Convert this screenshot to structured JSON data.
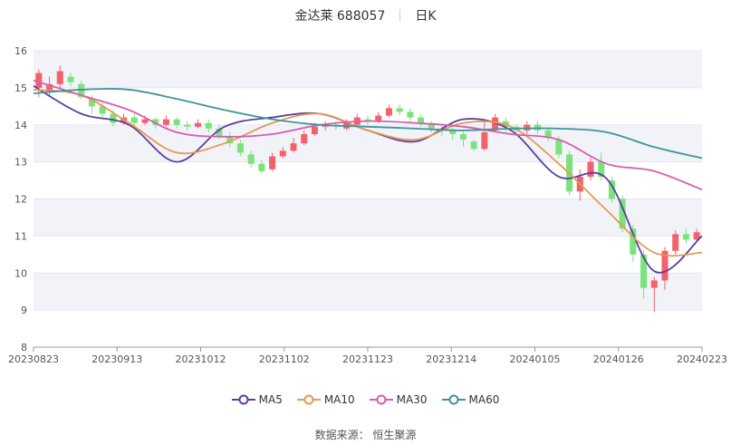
{
  "header": {
    "stock": "金达莱 688057",
    "period": "日K"
  },
  "source": "数据来源：  恒生聚源",
  "colors": {
    "up": "#f4606c",
    "down": "#7be37b",
    "band": "#f2f3f9",
    "MA5": "#5c3ea3",
    "MA10": "#e39b4f",
    "MA30": "#d65cb2",
    "MA60": "#3e9499"
  },
  "chart_data": {
    "type": "line",
    "title": "金达莱 688057 日K",
    "ylim": [
      8,
      16
    ],
    "yticks": [
      8,
      9,
      10,
      11,
      12,
      13,
      14,
      15,
      16
    ],
    "xticks": [
      "20230823",
      "20230913",
      "20231012",
      "20231102",
      "20231123",
      "20231214",
      "20240105",
      "20240126",
      "20240223"
    ],
    "dates": [
      "20230823",
      "20230913",
      "20231012",
      "20231102",
      "20231123",
      "20231214",
      "20240105",
      "20240126",
      "20240223"
    ],
    "series": [
      {
        "name": "MA5",
        "color": "#5c3ea3",
        "values": [
          15.05,
          14.3,
          14.0,
          13.0,
          13.95,
          14.2,
          14.3,
          13.85,
          13.55,
          14.15,
          13.85,
          12.6,
          12.55,
          10.05,
          11.0
        ]
      },
      {
        "name": "MA10",
        "color": "#e39b4f",
        "values": [
          14.95,
          14.8,
          14.05,
          13.25,
          13.5,
          14.05,
          14.3,
          13.85,
          13.6,
          14.05,
          13.95,
          12.95,
          11.7,
          10.55,
          10.55
        ]
      },
      {
        "name": "MA30",
        "color": "#d65cb2",
        "values": [
          15.2,
          14.8,
          14.4,
          13.8,
          13.68,
          13.75,
          14.0,
          14.1,
          14.05,
          13.95,
          13.75,
          13.6,
          12.95,
          12.75,
          12.25
        ]
      },
      {
        "name": "MA60",
        "color": "#3e9499",
        "values": [
          14.85,
          14.95,
          14.95,
          14.7,
          14.4,
          14.15,
          14.0,
          13.95,
          13.9,
          13.85,
          13.9,
          13.9,
          13.8,
          13.4,
          13.1
        ]
      }
    ],
    "candles": [
      [
        15.0,
        15.4,
        14.75,
        15.5
      ],
      [
        14.9,
        15.1,
        14.8,
        15.3
      ],
      [
        15.1,
        15.45,
        15.0,
        15.6
      ],
      [
        15.3,
        15.15,
        15.05,
        15.4
      ],
      [
        15.1,
        14.75,
        14.7,
        15.2
      ],
      [
        14.7,
        14.5,
        14.3,
        14.8
      ],
      [
        14.5,
        14.3,
        14.2,
        14.6
      ],
      [
        14.3,
        14.05,
        13.95,
        14.4
      ],
      [
        14.05,
        14.2,
        14.0,
        14.3
      ],
      [
        14.2,
        14.05,
        13.95,
        14.3
      ],
      [
        14.05,
        14.15,
        14.0,
        14.25
      ],
      [
        14.15,
        14.0,
        13.9,
        14.2
      ],
      [
        14.0,
        14.15,
        13.95,
        14.25
      ],
      [
        14.15,
        14.0,
        13.9,
        14.2
      ],
      [
        14.0,
        13.95,
        13.85,
        14.1
      ],
      [
        13.95,
        14.05,
        13.9,
        14.15
      ],
      [
        14.05,
        13.9,
        13.8,
        14.15
      ],
      [
        13.9,
        13.7,
        13.6,
        14.0
      ],
      [
        13.7,
        13.5,
        13.4,
        13.8
      ],
      [
        13.5,
        13.25,
        13.15,
        13.6
      ],
      [
        13.2,
        12.95,
        12.85,
        13.3
      ],
      [
        12.95,
        12.75,
        12.7,
        13.05
      ],
      [
        12.8,
        13.15,
        12.75,
        13.25
      ],
      [
        13.15,
        13.3,
        13.1,
        13.4
      ],
      [
        13.3,
        13.5,
        13.25,
        13.65
      ],
      [
        13.5,
        13.75,
        13.45,
        13.85
      ],
      [
        13.75,
        13.95,
        13.7,
        14.05
      ],
      [
        13.95,
        14.0,
        13.85,
        14.1
      ],
      [
        14.0,
        13.95,
        13.85,
        14.1
      ],
      [
        13.9,
        14.05,
        13.85,
        14.15
      ],
      [
        14.0,
        14.2,
        13.95,
        14.3
      ],
      [
        14.15,
        14.1,
        14.0,
        14.25
      ],
      [
        14.1,
        14.25,
        14.05,
        14.35
      ],
      [
        14.25,
        14.45,
        14.2,
        14.55
      ],
      [
        14.45,
        14.35,
        14.25,
        14.55
      ],
      [
        14.35,
        14.2,
        14.1,
        14.45
      ],
      [
        14.2,
        14.05,
        13.95,
        14.3
      ],
      [
        14.05,
        13.9,
        13.8,
        14.1
      ],
      [
        13.9,
        13.85,
        13.7,
        14.0
      ],
      [
        13.85,
        13.75,
        13.6,
        13.95
      ],
      [
        13.75,
        13.6,
        13.4,
        13.85
      ],
      [
        13.55,
        13.35,
        13.3,
        13.6
      ],
      [
        13.35,
        13.8,
        13.3,
        14.1
      ],
      [
        13.85,
        14.2,
        13.8,
        14.3
      ],
      [
        14.1,
        13.95,
        13.8,
        14.2
      ],
      [
        13.95,
        13.85,
        13.75,
        14.0
      ],
      [
        13.85,
        14.0,
        13.75,
        14.1
      ],
      [
        14.0,
        13.85,
        13.75,
        14.1
      ],
      [
        13.85,
        13.65,
        13.55,
        13.9
      ],
      [
        13.6,
        13.2,
        13.1,
        13.7
      ],
      [
        13.2,
        12.2,
        12.1,
        13.3
      ],
      [
        12.2,
        12.6,
        11.95,
        12.8
      ],
      [
        12.6,
        13.0,
        12.5,
        13.1
      ],
      [
        13.0,
        12.6,
        12.5,
        13.25
      ],
      [
        12.5,
        12.0,
        11.9,
        12.6
      ],
      [
        12.0,
        11.2,
        11.1,
        12.1
      ],
      [
        11.2,
        10.5,
        10.3,
        11.3
      ],
      [
        10.5,
        9.6,
        9.3,
        10.6
      ],
      [
        9.6,
        9.8,
        8.95,
        9.9
      ],
      [
        9.8,
        10.6,
        9.55,
        10.7
      ],
      [
        10.6,
        11.05,
        10.5,
        11.15
      ],
      [
        11.05,
        10.9,
        10.8,
        11.2
      ],
      [
        10.9,
        11.1,
        10.85,
        11.2
      ]
    ]
  }
}
